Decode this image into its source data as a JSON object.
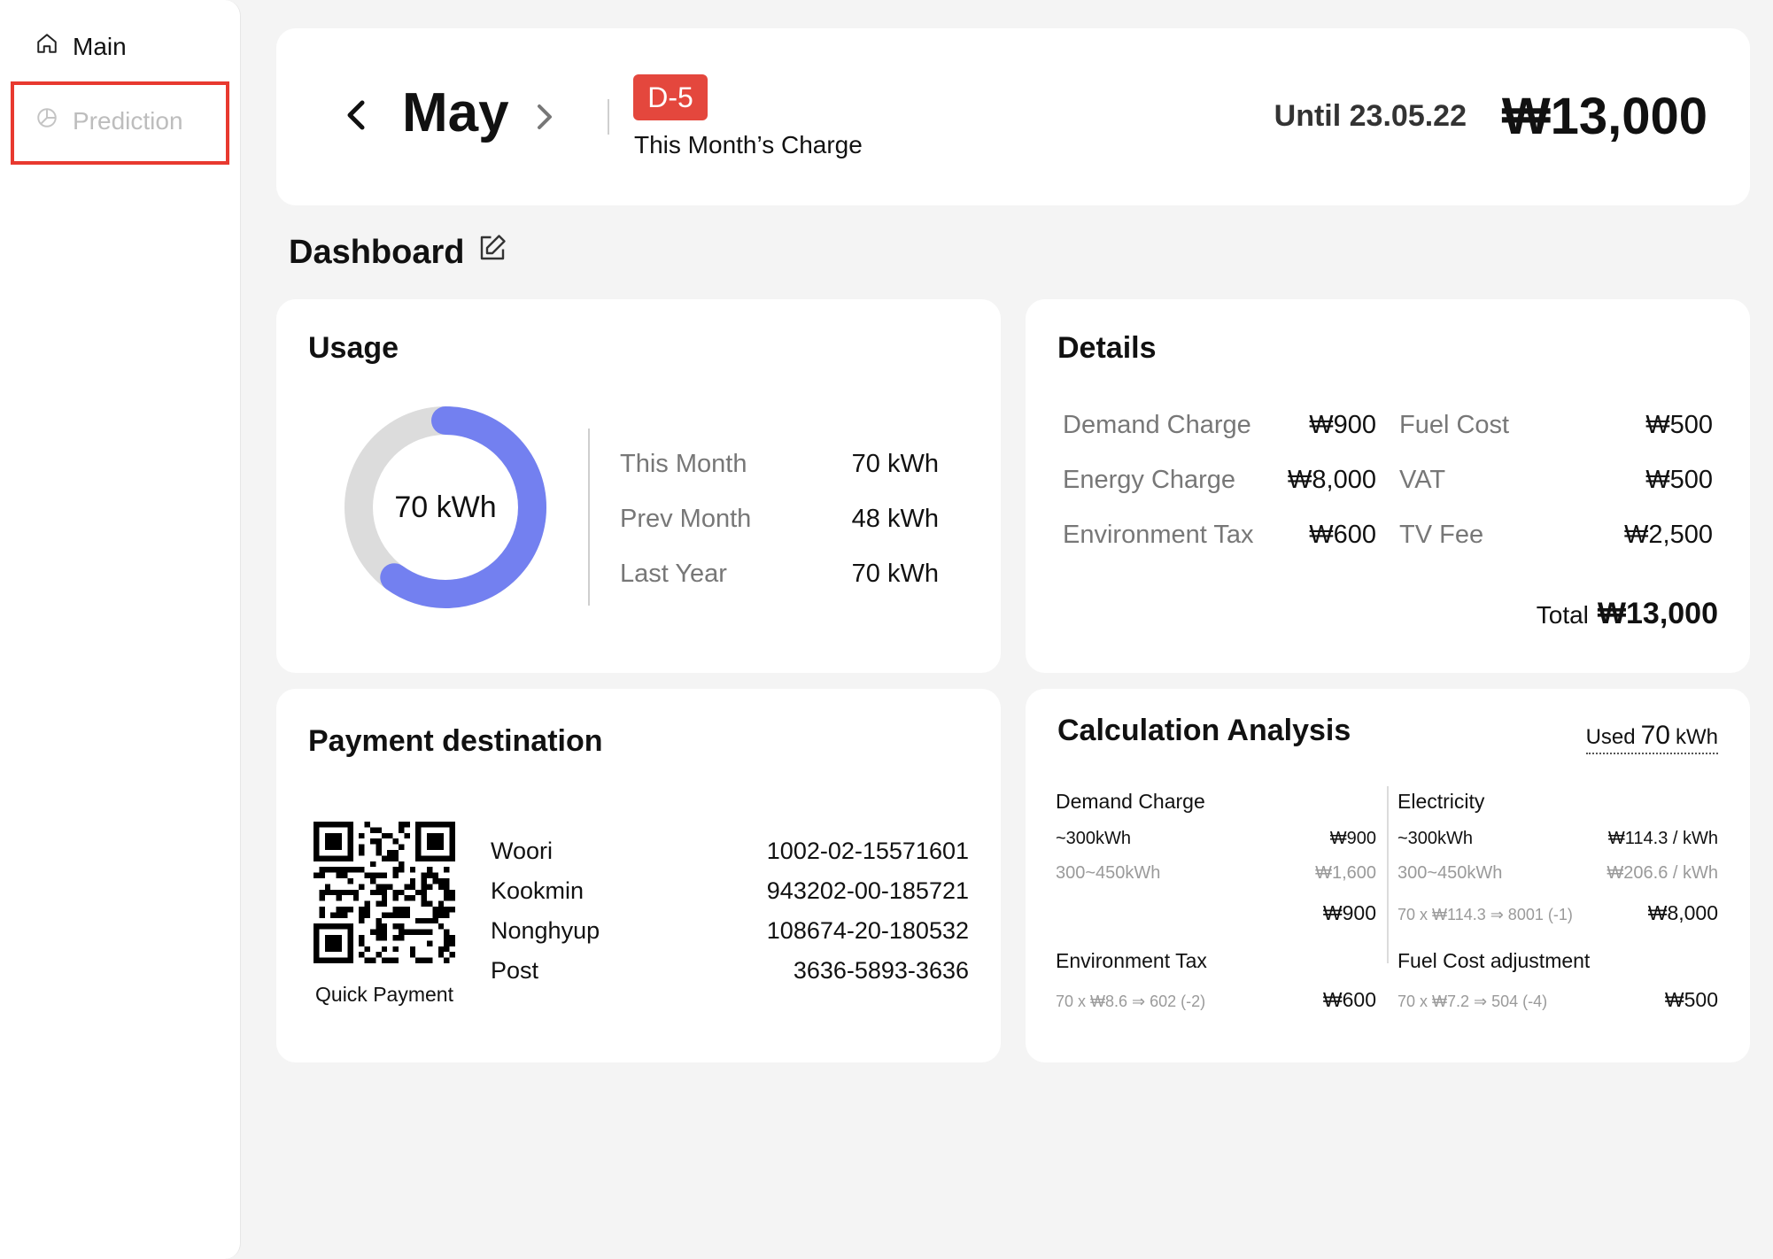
{
  "sidebar": {
    "items": [
      {
        "label": "Main",
        "icon": "home-icon",
        "active": true
      },
      {
        "label": "Prediction",
        "icon": "pie-chart-icon",
        "active": false
      }
    ]
  },
  "header": {
    "month": "May",
    "dday": "D-5",
    "charge_label": "This Month’s Charge",
    "until": "Until 23.05.22",
    "amount": "₩13,000"
  },
  "dashboard": {
    "title": "Dashboard"
  },
  "usage": {
    "title": "Usage",
    "donut_label": "70 kWh",
    "donut_fill_fraction": 0.6,
    "rows": [
      {
        "label": "This Month",
        "value": "70 kWh"
      },
      {
        "label": "Prev Month",
        "value": "48 kWh"
      },
      {
        "label": "Last Year",
        "value": "70 kWh"
      }
    ]
  },
  "details": {
    "title": "Details",
    "left": [
      {
        "label": "Demand Charge",
        "value": "₩900"
      },
      {
        "label": "Energy Charge",
        "value": "₩8,000"
      },
      {
        "label": "Environment Tax",
        "value": "₩600"
      }
    ],
    "right": [
      {
        "label": "Fuel Cost",
        "value": "₩500"
      },
      {
        "label": "VAT",
        "value": "₩500"
      },
      {
        "label": "TV Fee",
        "value": "₩2,500"
      }
    ],
    "total_label": "Total",
    "total_value": "₩13,000"
  },
  "payment": {
    "title": "Payment destination",
    "qr_label": "Quick Payment",
    "banks": [
      {
        "name": "Woori",
        "account": "1002-02-15571601"
      },
      {
        "name": "Kookmin",
        "account": "943202-00-185721"
      },
      {
        "name": "Nonghyup",
        "account": "108674-20-180532"
      },
      {
        "name": "Post",
        "account": "3636-5893-3636"
      }
    ]
  },
  "calc": {
    "title": "Calculation Analysis",
    "used_prefix": "Used",
    "used_value": "70",
    "used_unit": "kWh",
    "demand": {
      "title": "Demand Charge",
      "tier1_label": "~300kWh",
      "tier1_value": "₩900",
      "tier2_label": "300~450kWh",
      "tier2_value": "₩1,600",
      "total": "₩900"
    },
    "electricity": {
      "title": "Electricity",
      "tier1_label": "~300kWh",
      "tier1_value": "₩114.3 / kWh",
      "tier2_label": "300~450kWh",
      "tier2_value": "₩206.6 / kWh",
      "formula": "70 x ₩114.3 ⇒ 8001 (-1)",
      "total": "₩8,000"
    },
    "env_tax": {
      "title": "Environment Tax",
      "formula": "70 x ₩8.6 ⇒ 602 (-2)",
      "total": "₩600"
    },
    "fuel": {
      "title": "Fuel Cost adjustment",
      "formula": "70 x ₩7.2 ⇒ 504 (-4)",
      "total": "₩500"
    }
  },
  "colors": {
    "accent": "#7380f0",
    "track": "#dcdcdc",
    "dday_bg": "#e4473d",
    "highlight_border": "#e8392f"
  }
}
